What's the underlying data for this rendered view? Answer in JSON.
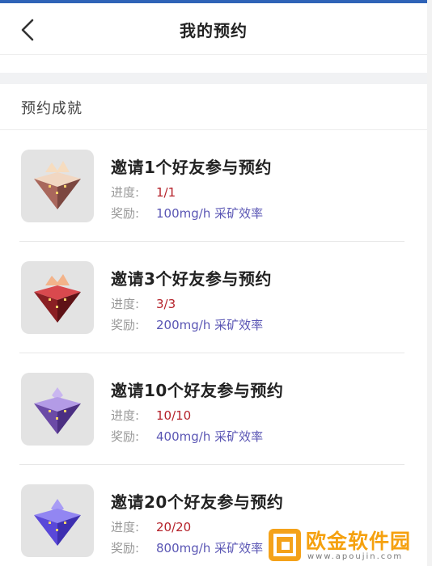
{
  "header": {
    "title": "我的预约",
    "back_icon": "chevron-left-icon"
  },
  "section": {
    "title": "预约成就"
  },
  "labels": {
    "progress": "进度:",
    "reward": "奖励:"
  },
  "achievements": [
    {
      "title": "邀请1个好友参与预约",
      "progress": "1/1",
      "reward": "100mg/h 采矿效率",
      "icon": "brown-crystal-badge-icon",
      "color": "#a7665a"
    },
    {
      "title": "邀请3个好友参与预约",
      "progress": "3/3",
      "reward": "200mg/h 采矿效率",
      "icon": "red-crystal-badge-icon",
      "color": "#8a1f23"
    },
    {
      "title": "邀请10个好友参与预约",
      "progress": "10/10",
      "reward": "400mg/h 采矿效率",
      "icon": "purple-crystal-badge-icon",
      "color": "#6b4aa6"
    },
    {
      "title": "邀请20个好友参与预约",
      "progress": "20/20",
      "reward": "800mg/h 采矿效率",
      "icon": "blue-violet-crystal-badge-icon",
      "color": "#5a48d8"
    }
  ],
  "colors": {
    "accent_progress": "#b5222a",
    "accent_reward": "#5a56b4",
    "topbar": "#2f63b7"
  },
  "watermark": {
    "text": "欧金软件园",
    "url": "www.apoujin.com"
  }
}
